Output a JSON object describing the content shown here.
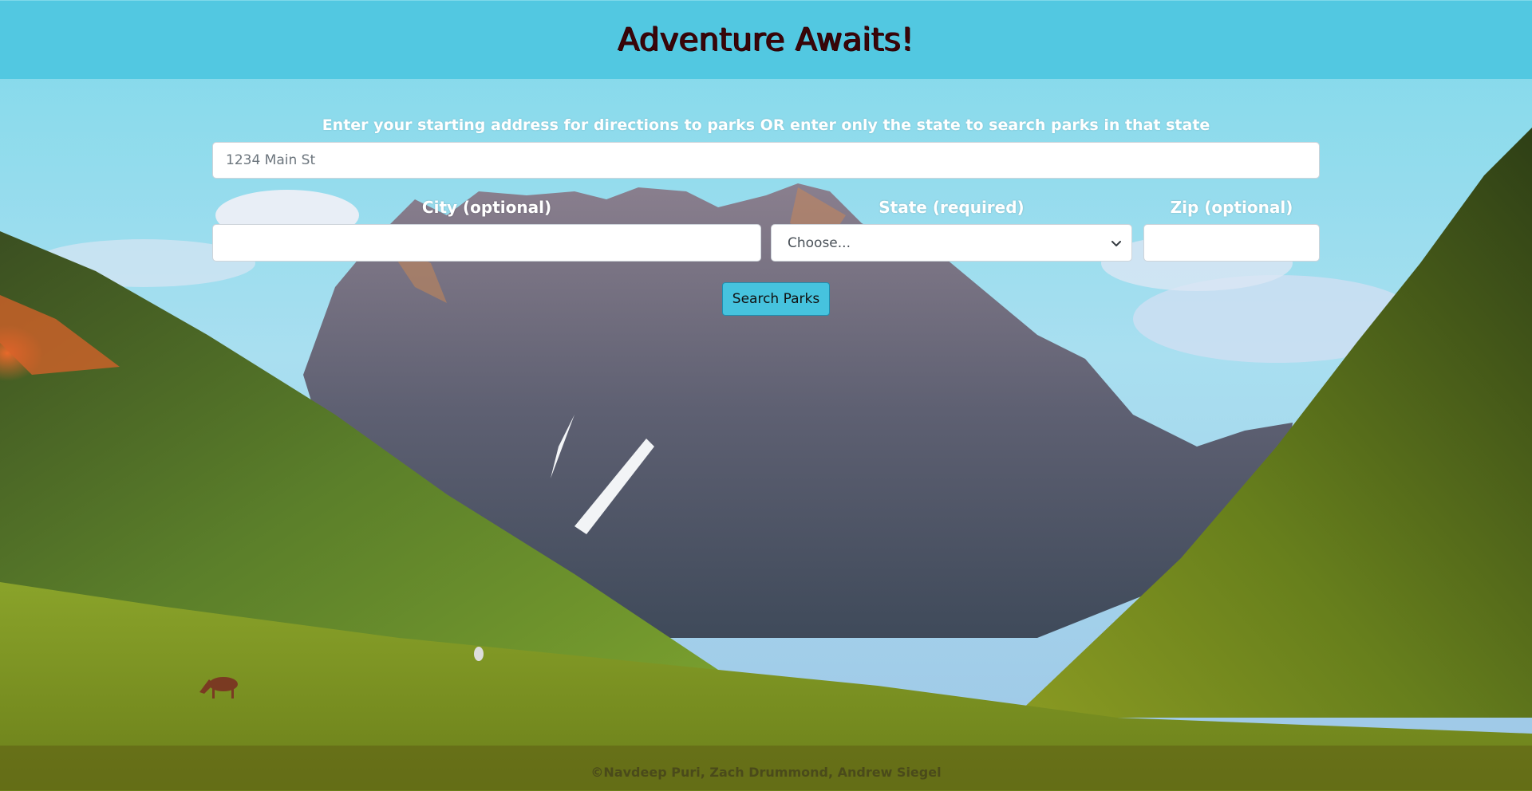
{
  "header": {
    "title": "Adventure Awaits!"
  },
  "form": {
    "intro_label": "Enter your starting address for directions to parks OR enter only the state to search parks in that state",
    "address": {
      "placeholder": "1234 Main St",
      "value": ""
    },
    "city": {
      "label": "City (optional)",
      "value": ""
    },
    "state": {
      "label": "State (required)",
      "selected": "Choose..."
    },
    "zip": {
      "label": "Zip (optional)",
      "value": ""
    },
    "submit_label": "Search Parks"
  },
  "footer": {
    "text": "©Navdeep Puri, Zach Drummond, Andrew Siegel"
  },
  "colors": {
    "navbar": "#52c8e1",
    "title": "#3a0509",
    "button": "#46c3de"
  },
  "icons": {
    "select_caret": "chevron-down-icon"
  }
}
